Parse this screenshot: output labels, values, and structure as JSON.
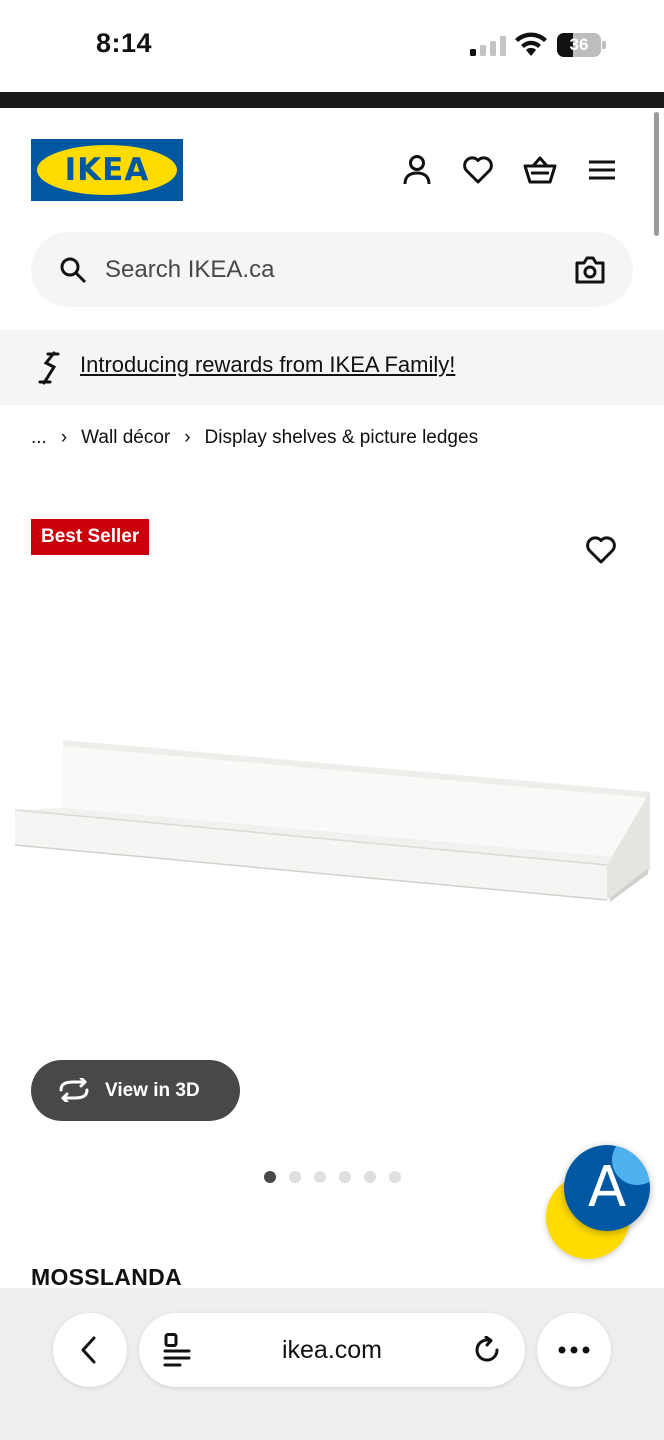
{
  "status_bar": {
    "time": "8:14",
    "battery_level": "36",
    "battery_percent": 36
  },
  "header": {
    "logo_text": "IKEA",
    "icons": [
      "account-icon",
      "heart-icon",
      "basket-icon",
      "menu-icon"
    ]
  },
  "search": {
    "placeholder": "Search IKEA.ca",
    "value": ""
  },
  "banner": {
    "link_text": "Introducing rewards from IKEA Family!"
  },
  "breadcrumb": {
    "items": [
      "...",
      "Wall décor",
      "Display shelves & picture ledges"
    ]
  },
  "product": {
    "badge": "Best Seller",
    "view3d_label": "View in 3D",
    "image_count": 6,
    "active_image": 1,
    "name": "MOSSLANDA"
  },
  "browser": {
    "url": "ikea.com"
  },
  "colors": {
    "ikea_blue": "#0058a3",
    "ikea_yellow": "#ffdb00",
    "badge_red": "#cc0008",
    "dark_gray": "#484848",
    "light_gray": "#f5f5f5"
  }
}
